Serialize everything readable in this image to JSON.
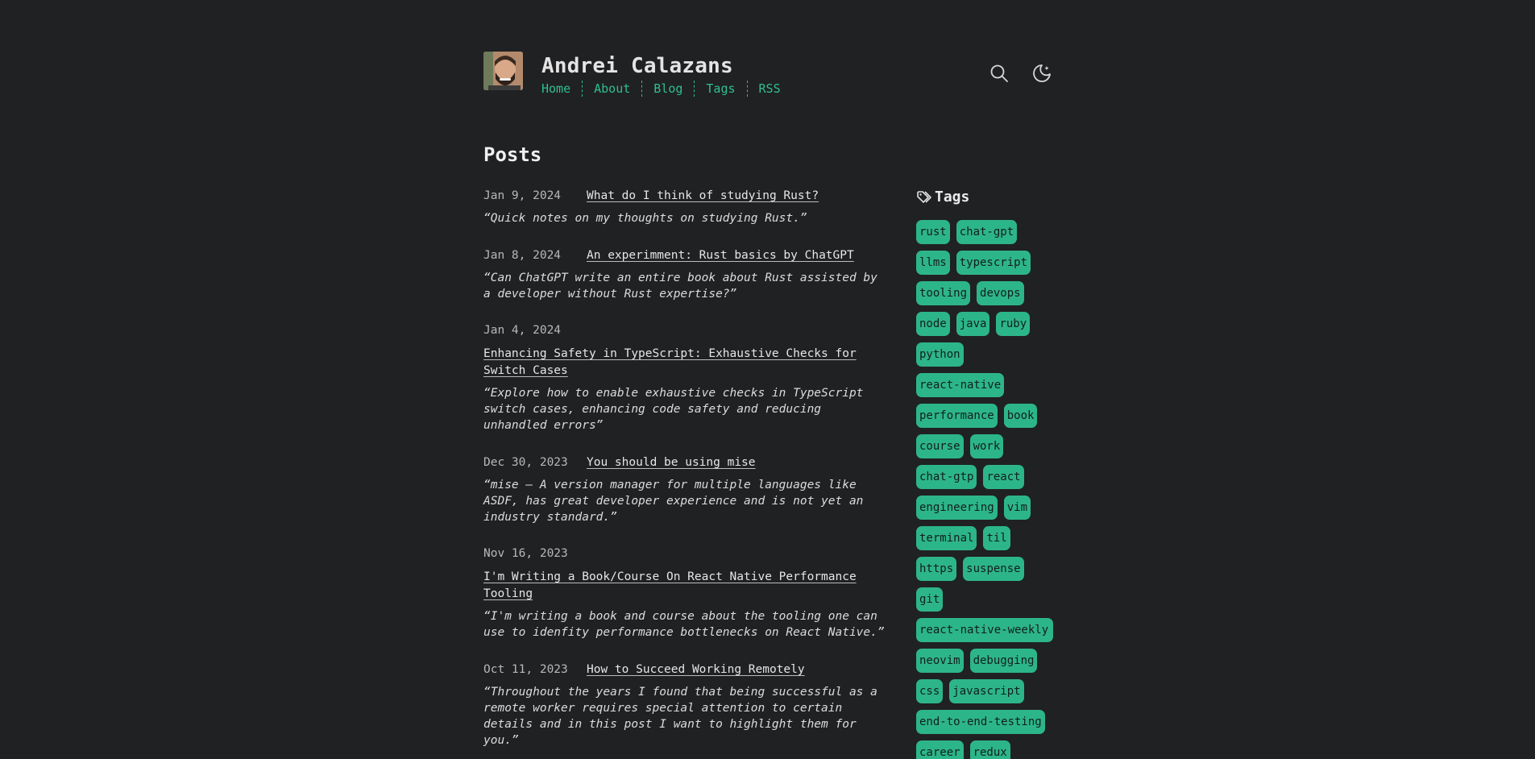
{
  "header": {
    "site_title": "Andrei Calazans",
    "nav": [
      "Home",
      "About",
      "Blog",
      "Tags",
      "RSS"
    ],
    "icons": [
      "search-icon",
      "moon-icon"
    ]
  },
  "posts_title": "Posts",
  "posts": [
    {
      "date": "Jan 9, 2024",
      "title": "What do I think of studying Rust?",
      "desc": "“Quick notes on my thoughts on studying Rust.”"
    },
    {
      "date": "Jan 8, 2024",
      "title": "An experimment: Rust basics by ChatGPT",
      "desc": "“Can ChatGPT write an entire book about Rust assisted by a developer without Rust expertise?”"
    },
    {
      "date": "Jan 4, 2024",
      "title": "Enhancing Safety in TypeScript: Exhaustive Checks for Switch Cases",
      "desc": "“Explore how to enable exhaustive checks in TypeScript switch cases, enhancing code safety and reducing unhandled errors”"
    },
    {
      "date": "Dec 30, 2023",
      "title": "You should be using mise",
      "desc": "“mise – A version manager for multiple languages like ASDF, has great developer experience and is not yet an industry standard.”"
    },
    {
      "date": "Nov 16, 2023",
      "title": "I'm Writing a Book/Course On React Native Performance Tooling",
      "desc": "“I'm writing a book and course about the tooling one can use to idenfity performance bottlenecks on React Native.”"
    },
    {
      "date": "Oct 11, 2023",
      "title": "How to Succeed Working Remotely",
      "desc": "“Throughout the years I found that being successful as a remote worker requires special attention to certain details and in this post I want to highlight them for you.”"
    }
  ],
  "tags_title": "Tags",
  "tags": [
    "rust",
    "chat-gpt",
    "llms",
    "typescript",
    "tooling",
    "devops",
    "node",
    "java",
    "ruby",
    "python",
    "react-native",
    "performance",
    "book",
    "course",
    "work",
    "chat-gtp",
    "react",
    "engineering",
    "vim",
    "terminal",
    "til",
    "https",
    "suspense",
    "git",
    "react-native-weekly",
    "neovim",
    "debugging",
    "css",
    "javascript",
    "end-to-end-testing",
    "career",
    "redux"
  ],
  "colors": {
    "background": "#202123",
    "accent": "#2fbf8f",
    "tag_bg": "#2db58a"
  }
}
